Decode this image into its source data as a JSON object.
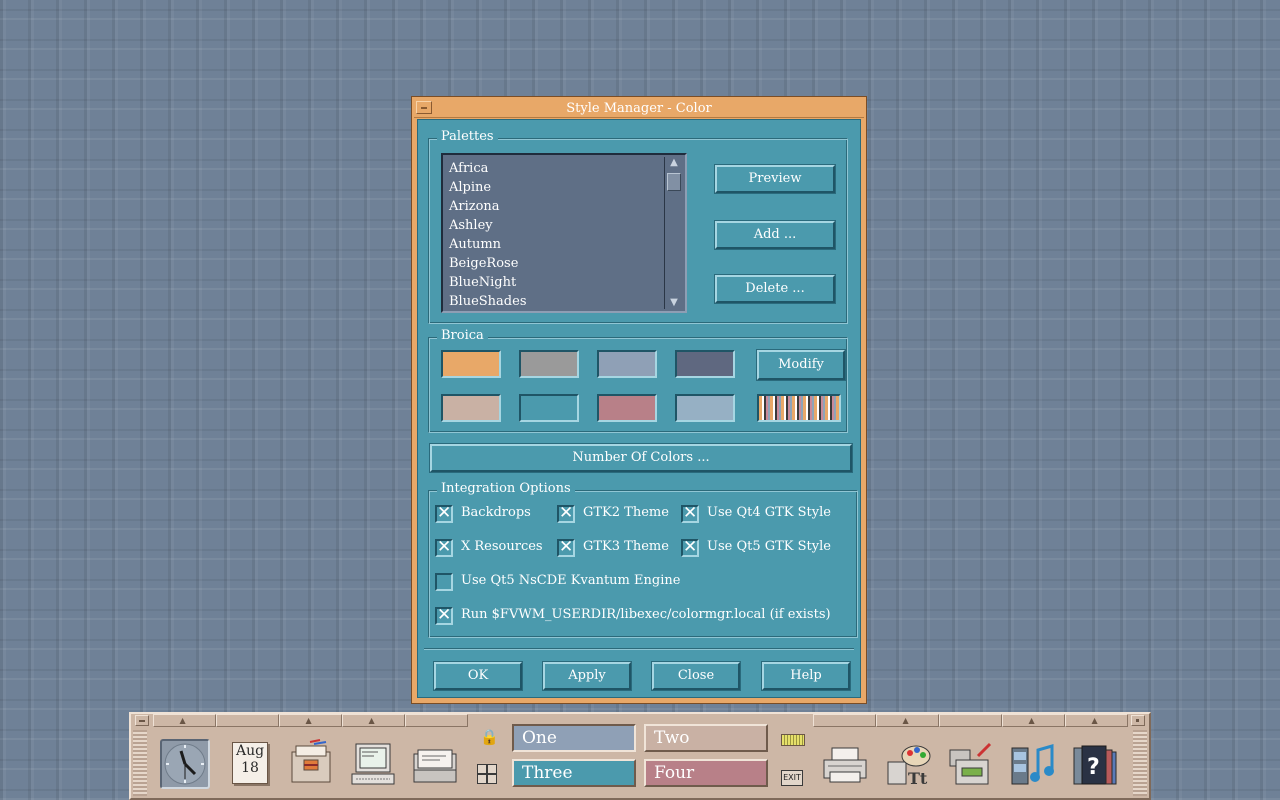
{
  "window": {
    "title": "Style Manager - Color"
  },
  "palettes": {
    "label": "Palettes",
    "items": [
      "Africa",
      "Alpine",
      "Arizona",
      "Ashley",
      "Autumn",
      "BeigeRose",
      "BlueNight",
      "BlueShades"
    ],
    "preview_label": "Preview",
    "add_label": "Add ...",
    "delete_label": "Delete ..."
  },
  "broica": {
    "label": "Broica",
    "modify_label": "Modify",
    "swatches": [
      "#e8a868",
      "#9a9a9a",
      "#8fa0b6",
      "#5f6880",
      "#c9b1a4",
      "#4b9aad",
      "#b88088",
      "#96b0c4"
    ]
  },
  "number_of_colors_label": "Number Of Colors ...",
  "integration": {
    "label": "Integration Options",
    "options": [
      {
        "label": "Backdrops",
        "checked": true
      },
      {
        "label": "GTK2 Theme",
        "checked": true
      },
      {
        "label": "Use Qt4 GTK Style",
        "checked": true
      },
      {
        "label": "X Resources",
        "checked": true
      },
      {
        "label": "GTK3 Theme",
        "checked": true
      },
      {
        "label": "Use Qt5 GTK Style",
        "checked": true
      },
      {
        "label": "Use Qt5 NsCDE Kvantum Engine",
        "checked": false
      },
      {
        "label": "Run $FVWM_USERDIR/libexec/colormgr.local (if exists)",
        "checked": true
      }
    ]
  },
  "dialog_buttons": {
    "ok": "OK",
    "apply": "Apply",
    "close": "Close",
    "help": "Help"
  },
  "front_panel": {
    "calendar_month": "Aug",
    "calendar_day": "18",
    "workspaces": [
      {
        "label": "One",
        "color": "#8fa0b6",
        "active": true
      },
      {
        "label": "Two",
        "color": "#c9b1a4",
        "active": false
      },
      {
        "label": "Three",
        "color": "#4b9aad",
        "active": false
      },
      {
        "label": "Four",
        "color": "#b88088",
        "active": false
      }
    ],
    "exit_label": "EXIT",
    "icons": [
      "clock-icon",
      "calendar-icon",
      "file-manager-icon",
      "terminal-icon",
      "mail-icon",
      "printer-icon",
      "style-manager-icon",
      "app-manager-icon",
      "media-icon",
      "help-icon"
    ]
  }
}
